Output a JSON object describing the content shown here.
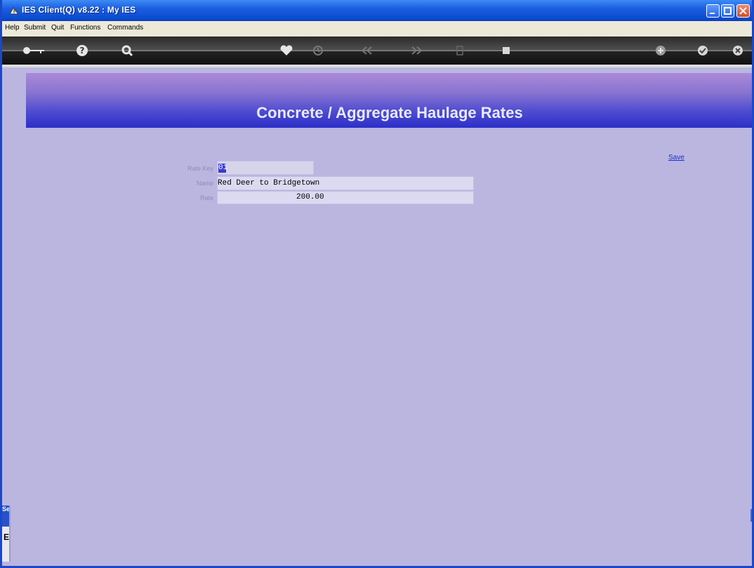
{
  "window": {
    "title": "IES Client(Q) v8.22 : My IES"
  },
  "menu": {
    "items": [
      {
        "label": "Help"
      },
      {
        "label": "Submit"
      },
      {
        "label": "Quit"
      },
      {
        "label": "Functions"
      },
      {
        "label": "Commands"
      }
    ]
  },
  "toolbar": {
    "icons": [
      "key-icon",
      "help-icon",
      "search-icon",
      "heart-icon",
      "clock-icon",
      "rewind-icon",
      "fast-forward-icon",
      "document-icon",
      "stop-icon",
      "plus-icon",
      "check-icon",
      "close-icon"
    ]
  },
  "banner": {
    "title": "Concrete / Aggregate Haulage Rates"
  },
  "form": {
    "rate_key_label": "Rate Key",
    "rate_key_value": "01",
    "name_label": "Name",
    "name_value": "Red Deer to Bridgetown",
    "rate_label": "Rate",
    "rate_value": "200.00"
  },
  "actions": {
    "save_label": "Save"
  },
  "side": {
    "tab_label": "Se",
    "char": "E"
  },
  "colors": {
    "background": "#bab6e0",
    "banner_top": "#a98ad8",
    "banner_bottom": "#2c2fc8",
    "link": "#1a2ad8"
  }
}
